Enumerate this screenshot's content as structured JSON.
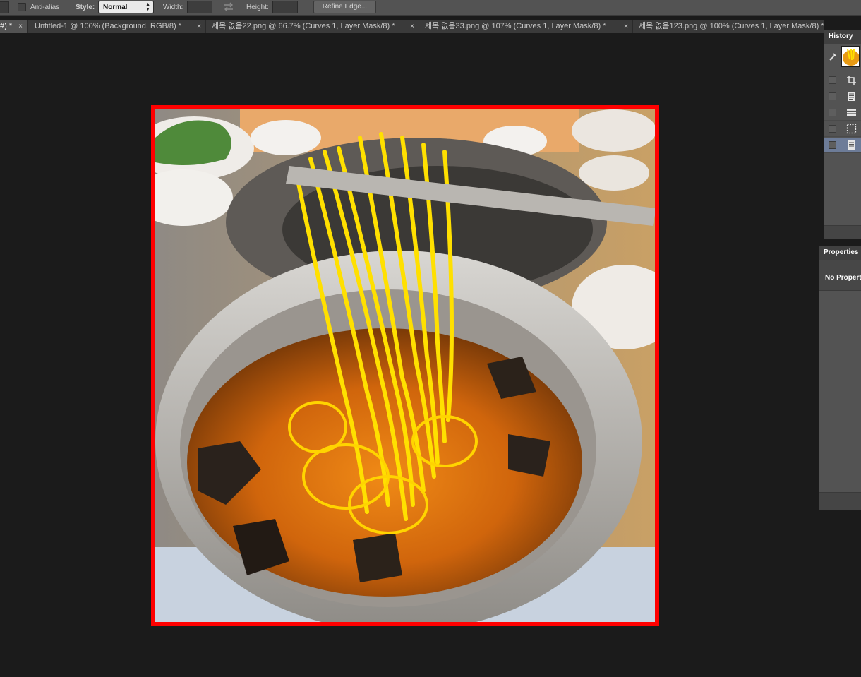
{
  "options_bar": {
    "anti_alias_label": "Anti-alias",
    "style_label": "Style:",
    "style_value": "Normal",
    "width_label": "Width:",
    "height_label": "Height:",
    "refine_edge_label": "Refine Edge..."
  },
  "tabs": [
    {
      "label": "#) *",
      "active": true
    },
    {
      "label": "Untitled-1 @ 100% (Background, RGB/8) *"
    },
    {
      "label": "제목 없음22.png @ 66.7% (Curves 1, Layer Mask/8) *"
    },
    {
      "label": "제목 없음33.png @ 107% (Curves 1, Layer Mask/8) *"
    },
    {
      "label": "제목 없음123.png @ 100% (Curves 1, Layer Mask/8) *"
    }
  ],
  "tab_close_glyph": "×",
  "history": {
    "title": "History",
    "steps": [
      {
        "icon": "crop-icon"
      },
      {
        "icon": "document-icon"
      },
      {
        "icon": "layers-icon"
      },
      {
        "icon": "marquee-icon"
      },
      {
        "icon": "document-icon",
        "selected": true
      }
    ]
  },
  "properties": {
    "title": "Properties",
    "empty_message": "No Properties"
  },
  "colors": {
    "selection_border": "#ff0000",
    "canvas_bg": "#1b1b1b",
    "panel_bg": "#535353",
    "selected_step": "#6d7c98"
  }
}
